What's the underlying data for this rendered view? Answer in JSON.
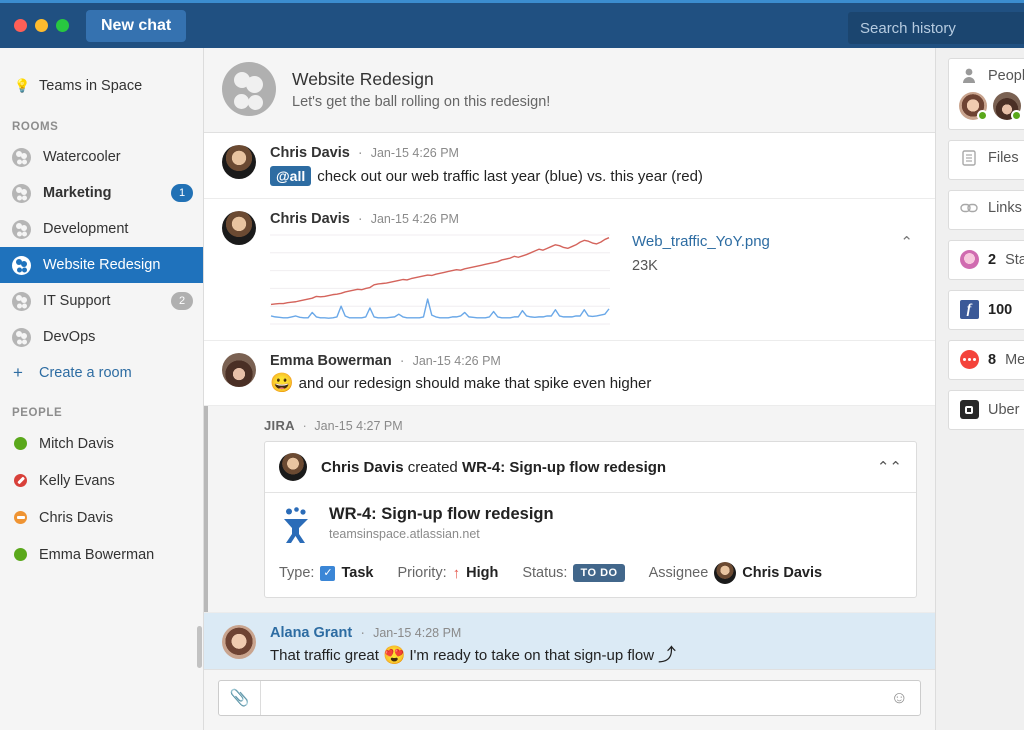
{
  "titlebar": {
    "new_chat_label": "New chat",
    "search_placeholder": "Search history",
    "bg_color": "#205081",
    "accent_top": "#3b8dd0"
  },
  "sidebar": {
    "team": {
      "label": "Teams in Space",
      "icon": "lightbulb-icon"
    },
    "rooms_heading": "ROOMS",
    "rooms": [
      {
        "label": "Watercooler",
        "badge": "",
        "unread": false,
        "active": false
      },
      {
        "label": "Marketing",
        "badge": "1",
        "unread": true,
        "active": false,
        "badge_color": "#2171b5"
      },
      {
        "label": "Development",
        "badge": "",
        "unread": false,
        "active": false
      },
      {
        "label": "Website Redesign",
        "badge": "",
        "unread": false,
        "active": true
      },
      {
        "label": "IT Support",
        "badge": "2",
        "unread": false,
        "active": false,
        "badge_color": "#b0b0b0"
      },
      {
        "label": "DevOps",
        "badge": "",
        "unread": false,
        "active": false
      }
    ],
    "create_room_label": "Create a room",
    "people_heading": "PEOPLE",
    "people": [
      {
        "name": "Mitch Davis",
        "status": "online"
      },
      {
        "name": "Kelly Evans",
        "status": "busy"
      },
      {
        "name": "Chris Davis",
        "status": "away"
      },
      {
        "name": "Emma Bowerman",
        "status": "online"
      }
    ],
    "active_color": "#1f72bc"
  },
  "room_header": {
    "title": "Website Redesign",
    "topic": "Let's get the ball rolling on this redesign!"
  },
  "messages": [
    {
      "author": "Chris Davis",
      "time": "Jan-15 4:26 PM",
      "mention": "@all",
      "text": "check out our web traffic last year (blue) vs. this year (red)"
    },
    {
      "author": "Chris Davis",
      "time": "Jan-15 4:26 PM",
      "attachment": {
        "filename": "Web_traffic_YoY.png",
        "filesize": "23K",
        "collapse_icon": "chevron-up-icon"
      }
    },
    {
      "author": "Emma Bowerman",
      "time": "Jan-15 4:26 PM",
      "emoji": "😀",
      "text": "and our redesign should make that spike even higher"
    }
  ],
  "jira_message": {
    "app": "JIRA",
    "time": "Jan-15 4:27 PM",
    "activity_prefix": "Chris Davis",
    "activity_verb": "created",
    "activity_issue": "WR-4: Sign-up flow redesign",
    "collapse_icon": "chevrons-up-icon",
    "issue_title": "WR-4: Sign-up flow redesign",
    "issue_url": "teamsinspace.atlassian.net",
    "fields": {
      "type_label": "Type:",
      "type_value": "Task",
      "priority_label": "Priority:",
      "priority_value": "High",
      "status_label": "Status:",
      "status_value": "TO DO",
      "assignee_label": "Assignee",
      "assignee_value": "Chris Davis"
    }
  },
  "last_message": {
    "author": "Alana Grant",
    "time": "Jan-15 4:28 PM",
    "text_before": "That traffic great",
    "emoji": "😍",
    "text_after": "I'm ready to take on that sign-up flow",
    "trailing_glyph": "⤴"
  },
  "composer": {
    "placeholder": "",
    "value": "",
    "attach_icon": "paperclip-icon",
    "emoji_icon": "smiley-icon"
  },
  "right_panel": {
    "cards": [
      {
        "icon": "person-icon",
        "label": "People",
        "count": ""
      },
      {
        "icon": "file-icon",
        "label": "Files",
        "count": ""
      },
      {
        "icon": "link-icon",
        "label": "Links",
        "count": ""
      },
      {
        "icon": "star-icon",
        "label": "Stars",
        "count": "2"
      },
      {
        "icon": "facebook-icon",
        "label": "",
        "count": "100"
      },
      {
        "icon": "messages-icon",
        "label": "Messages",
        "count": "8"
      },
      {
        "icon": "uber-icon",
        "label": "Uber",
        "count": ""
      }
    ]
  },
  "chart_data": {
    "type": "line",
    "title": "Web_traffic_YoY.png",
    "xlabel": "",
    "ylabel": "",
    "grid": true,
    "legend_position": "none",
    "series": [
      {
        "name": "this year (red)",
        "color": "#d4645c",
        "values": [
          22,
          22.5,
          23,
          23,
          24,
          24.5,
          25,
          26,
          27,
          28,
          29,
          31,
          30.5,
          31,
          32,
          33,
          33.5,
          34.5,
          36,
          37,
          38,
          39,
          38.5,
          40,
          41,
          44,
          45,
          45.5,
          46,
          47,
          48,
          49,
          50,
          49.5,
          51,
          52,
          53,
          54,
          55,
          54.5,
          56,
          57,
          58,
          59,
          60,
          61,
          60.5,
          62,
          63,
          64,
          65,
          66,
          67,
          68,
          69,
          70,
          72,
          73,
          74,
          76,
          75,
          76.5,
          78,
          80,
          82,
          84,
          83,
          85,
          87,
          89,
          88,
          86,
          85,
          87,
          89,
          92,
          94,
          93,
          91,
          90,
          92,
          95,
          97
        ]
      },
      {
        "name": "last year (blue)",
        "color": "#6aa8e8",
        "values": [
          9,
          8,
          7.5,
          7,
          7,
          8,
          9,
          7.5,
          7,
          7,
          13,
          8,
          7,
          7,
          6.5,
          7,
          8,
          20,
          9,
          7,
          7,
          7,
          7,
          8,
          18,
          8,
          7,
          7,
          7,
          7.5,
          8,
          11,
          8,
          7,
          7,
          7,
          7,
          8,
          28,
          10,
          8,
          7,
          7,
          7,
          8,
          8,
          9,
          13,
          8,
          7.5,
          7,
          7,
          7,
          8,
          14,
          8,
          7,
          7,
          7,
          8,
          8,
          15,
          9,
          8,
          7.5,
          8,
          8,
          9,
          9,
          16,
          9,
          8,
          8,
          8,
          9,
          9,
          16,
          9,
          8.5,
          9,
          10,
          11,
          17
        ]
      }
    ],
    "ylim": [
      0,
      100
    ],
    "xlim": [
      0,
      82
    ]
  }
}
